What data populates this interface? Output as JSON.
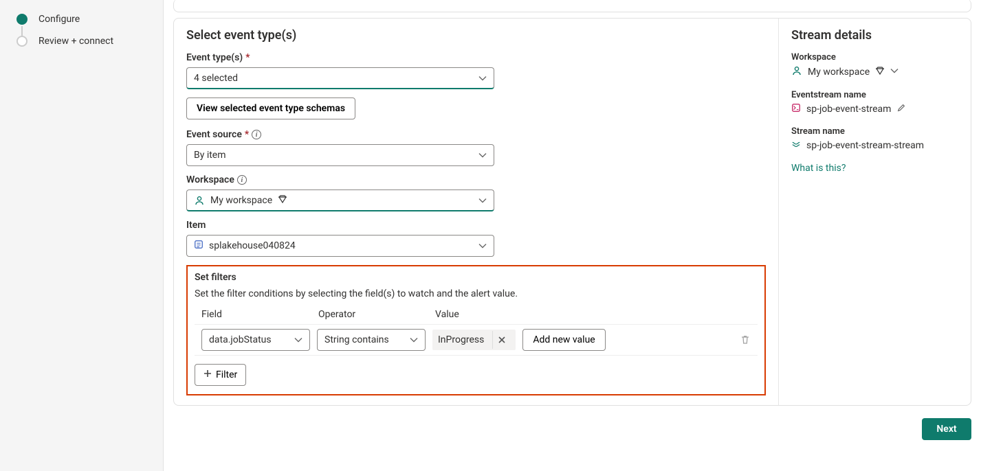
{
  "stepper": {
    "steps": [
      {
        "label": "Configure",
        "active": true
      },
      {
        "label": "Review + connect",
        "active": false
      }
    ]
  },
  "form": {
    "section_title": "Select event type(s)",
    "event_types": {
      "label": "Event type(s)",
      "value": "4 selected"
    },
    "view_schemas_label": "View selected event type schemas",
    "event_source": {
      "label": "Event source",
      "value": "By item"
    },
    "workspace": {
      "label": "Workspace",
      "value": "My workspace"
    },
    "item": {
      "label": "Item",
      "value": "splakehouse040824"
    }
  },
  "filters": {
    "title": "Set filters",
    "description": "Set the filter conditions by selecting the field(s) to watch and the alert value.",
    "header": {
      "field": "Field",
      "operator": "Operator",
      "value": "Value"
    },
    "row": {
      "field": "data.jobStatus",
      "operator": "String contains",
      "value": "InProgress",
      "add_value_label": "Add new value"
    },
    "add_filter_label": "Filter"
  },
  "details": {
    "title": "Stream details",
    "workspace": {
      "label": "Workspace",
      "value": "My workspace"
    },
    "eventstream": {
      "label": "Eventstream name",
      "value": "sp-job-event-stream"
    },
    "stream": {
      "label": "Stream name",
      "value": "sp-job-event-stream-stream"
    },
    "help_link": "What is this?"
  },
  "footer": {
    "next_label": "Next"
  }
}
